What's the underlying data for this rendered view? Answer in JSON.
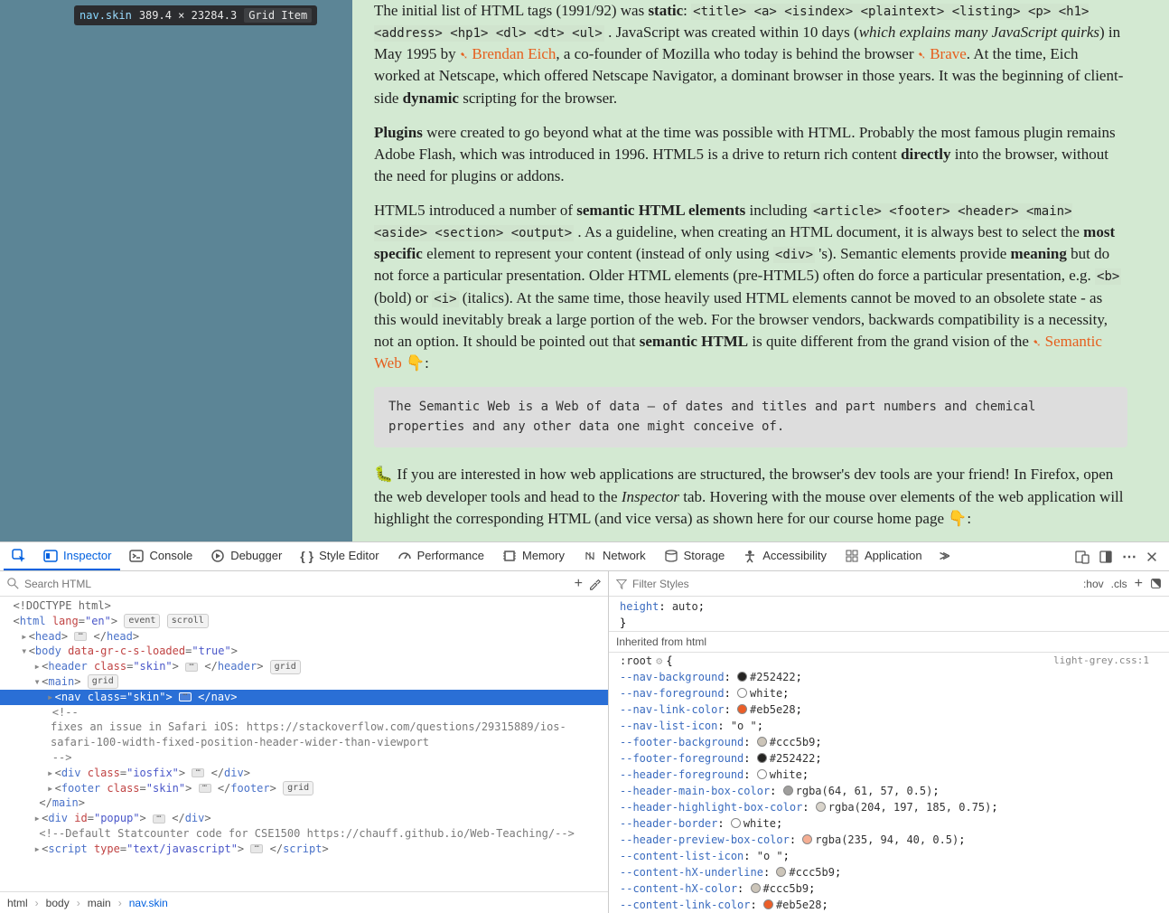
{
  "hover_tooltip": {
    "ns": "nav",
    "cls": ".skin",
    "dims": "389.4 × 23284.3",
    "chip": "Grid Item"
  },
  "article": {
    "p1": {
      "t1": "The initial list of HTML tags (1991/92) was ",
      "b1": "static",
      "t2": ": ",
      "tags": "<title> <a> <isindex> <plaintext> <listing> <p> <h1> <address> <hp1> <dl> <dt> <ul>",
      "t3": " . JavaScript was created within 10 days (",
      "i1": "which explains many JavaScript quirks",
      "t4": ") in May 1995 by ",
      "a1": "Brendan Eich",
      "t5": ", a co-founder of Mozilla who today is behind the browser ",
      "a2": "Brave",
      "t6": ". At the time, Eich worked at Netscape, which offered Netscape Navigator, a dominant browser in those years. It was the beginning of client-side ",
      "b2": "dynamic",
      "t7": " scripting for the browser."
    },
    "p2": {
      "b1": "Plugins",
      "t1": " were created to go beyond what at the time was possible with HTML. Probably the most famous plugin remains Adobe Flash, which was introduced in 1996. HTML5 is a drive to return rich content ",
      "b2": "directly",
      "t2": " into the browser, without the need for plugins or addons."
    },
    "p3": {
      "t1": "HTML5 introduced a number of ",
      "b1": "semantic HTML elements",
      "t2": " including ",
      "tags": "<article> <footer> <header> <main> <aside> <section> <output>",
      "t3": " . As a guideline, when creating an HTML document, it is always best to select the ",
      "b2": "most specific",
      "t4": " element to represent your content (instead of only using ",
      "c1": "<div>",
      "t5": " 's). Semantic elements provide ",
      "b3": "meaning",
      "t6": " but do not force a particular presentation. Older HTML elements (pre-HTML5) often do force a particular presentation, e.g. ",
      "c2": "<b>",
      "t7": " (bold) or ",
      "c3": "<i>",
      "t8": " (italics). At the same time, those heavily used HTML elements cannot be moved to an obsolete state - as this would inevitably break a large portion of the web. For the browser vendors, backwards compatibility is a necessity, not an option. It should be pointed out that ",
      "b4": "semantic HTML",
      "t9": " is quite different from the grand vision of the ",
      "a1": "Semantic Web",
      "t10": " 👇:"
    },
    "quote": "The Semantic Web is a Web of data — of dates and titles and part numbers and chemical properties and any other data one might conceive of.",
    "p4": {
      "t1": "🐛 If you are interested in how web applications are structured, the browser's dev tools are your friend! In Firefox, open the web developer tools and head to the ",
      "i1": "Inspector",
      "t2": " tab. Hovering with the mouse over elements of the web application will highlight the corresponding HTML (and vice versa) as shown here for our course home page 👇:"
    }
  },
  "devtools": {
    "tabs": {
      "inspector": "Inspector",
      "console": "Console",
      "debugger": "Debugger",
      "style": "Style Editor",
      "perf": "Performance",
      "memory": "Memory",
      "network": "Network",
      "storage": "Storage",
      "a11y": "Accessibility",
      "app": "Application"
    },
    "search_placeholder": "Search HTML",
    "filter_placeholder": "Filter Styles",
    "hov": ":hov",
    "cls": ".cls",
    "tree": {
      "doctype": "<!DOCTYPE html>",
      "html_open": [
        "html",
        "lang",
        "\"en\""
      ],
      "html_chips": [
        "event",
        "scroll"
      ],
      "head": "head",
      "body": [
        "body",
        "data-gr-c-s-loaded",
        "\"true\""
      ],
      "header": [
        "header",
        "class",
        "\"skin\""
      ],
      "header_chip": "grid",
      "main": "main",
      "main_chip": "grid",
      "nav": [
        "nav",
        "class",
        "\"skin\""
      ],
      "comment": "fixes an issue in Safari iOS: https://stackoverflow.com/questions/29315889/ios-safari-100-width-fixed-position-header-wider-than-viewport",
      "iosfix": [
        "div",
        "class",
        "\"iosfix\""
      ],
      "footer": [
        "footer",
        "class",
        "\"skin\""
      ],
      "footer_chip": "grid",
      "main_close": "main",
      "popup": [
        "div",
        "id",
        "\"popup\""
      ],
      "statcomment": "Default Statcounter code for CSE1500 https://chauff.github.io/Web-Teaching/",
      "script": [
        "script",
        "type",
        "\"text/javascript\""
      ]
    },
    "crumb": [
      "html",
      "body",
      "main",
      "nav.skin"
    ],
    "css": {
      "pre": [
        {
          "p": "height",
          "v": "auto"
        }
      ],
      "inherit": "Inherited from html",
      "selector": ":root",
      "file": "light-grey.css:1",
      "rules": [
        {
          "p": "--nav-background",
          "c": "#252422",
          "v": "#252422"
        },
        {
          "p": "--nav-foreground",
          "c": "#ffffff",
          "v": "white"
        },
        {
          "p": "--nav-link-color",
          "c": "#eb5e28",
          "v": "#eb5e28"
        },
        {
          "p": "--nav-list-icon",
          "v": "\"ο \""
        },
        {
          "p": "--footer-background",
          "c": "#ccc5b9",
          "v": "#ccc5b9"
        },
        {
          "p": "--footer-foreground",
          "c": "#252422",
          "v": "#252422"
        },
        {
          "p": "--header-foreground",
          "c": "#ffffff",
          "v": "white"
        },
        {
          "p": "--header-main-box-color",
          "c": "rgba(64,61,57,0.5)",
          "v": "rgba(64, 61, 57, 0.5)"
        },
        {
          "p": "--header-highlight-box-color",
          "c": "rgba(204,197,185,0.75)",
          "v": "rgba(204, 197, 185, 0.75)"
        },
        {
          "p": "--header-border",
          "c": "#ffffff",
          "v": "white"
        },
        {
          "p": "--header-preview-box-color",
          "c": "rgba(235,94,40,0.5)",
          "v": "rgba(235, 94, 40, 0.5)"
        },
        {
          "p": "--content-list-icon",
          "v": "\"ο \""
        },
        {
          "p": "--content-hX-underline",
          "c": "#ccc5b9",
          "v": "#ccc5b9"
        },
        {
          "p": "--content-hX-color",
          "c": "#ccc5b9",
          "v": "#ccc5b9"
        },
        {
          "p": "--content-link-color",
          "c": "#eb5e28",
          "v": "#eb5e28"
        }
      ]
    }
  }
}
